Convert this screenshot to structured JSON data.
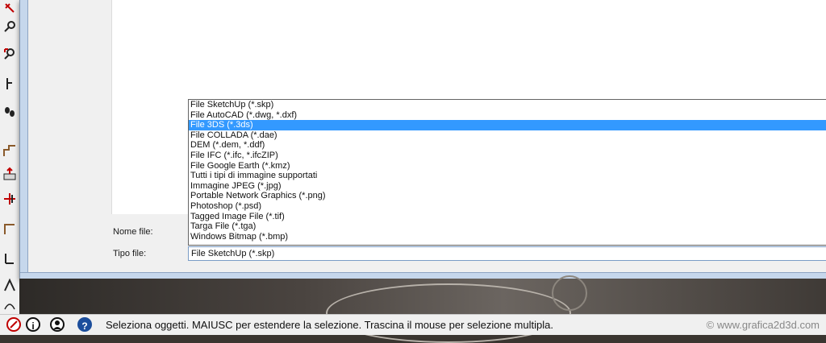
{
  "dialog": {
    "nome_file_label": "Nome file:",
    "tipo_file_label": "Tipo file:",
    "tipo_file_value": "File SketchUp (*.skp)",
    "file_types": [
      "File SketchUp (*.skp)",
      "File AutoCAD (*.dwg, *.dxf)",
      "File 3DS (*.3ds)",
      "File COLLADA (*.dae)",
      "DEM (*.dem, *.ddf)",
      "File IFC (*.ifc, *.ifcZIP)",
      "File Google Earth (*.kmz)",
      "Tutti i tipi di immagine supportati",
      "Immagine JPEG (*.jpg)",
      "Portable Network Graphics (*.png)",
      "Photoshop (*.psd)",
      "Tagged Image File (*.tif)",
      "Targa File (*.tga)",
      "Windows Bitmap (*.bmp)"
    ],
    "selected_index": 2
  },
  "statusbar": {
    "text": "Seleziona oggetti. MAIUSC per estendere la selezione. Trascina il mouse per selezione multipla.",
    "icons": [
      "geo-location-icon",
      "info-icon",
      "user-icon",
      "help-icon"
    ],
    "help_glyph": "?",
    "info_glyph": "i"
  },
  "watermark": "© www.grafica2d3d.com",
  "colors": {
    "selection": "#3399ff",
    "dialog_bg": "#f0f0f0",
    "frame": "#c6d7ec"
  }
}
